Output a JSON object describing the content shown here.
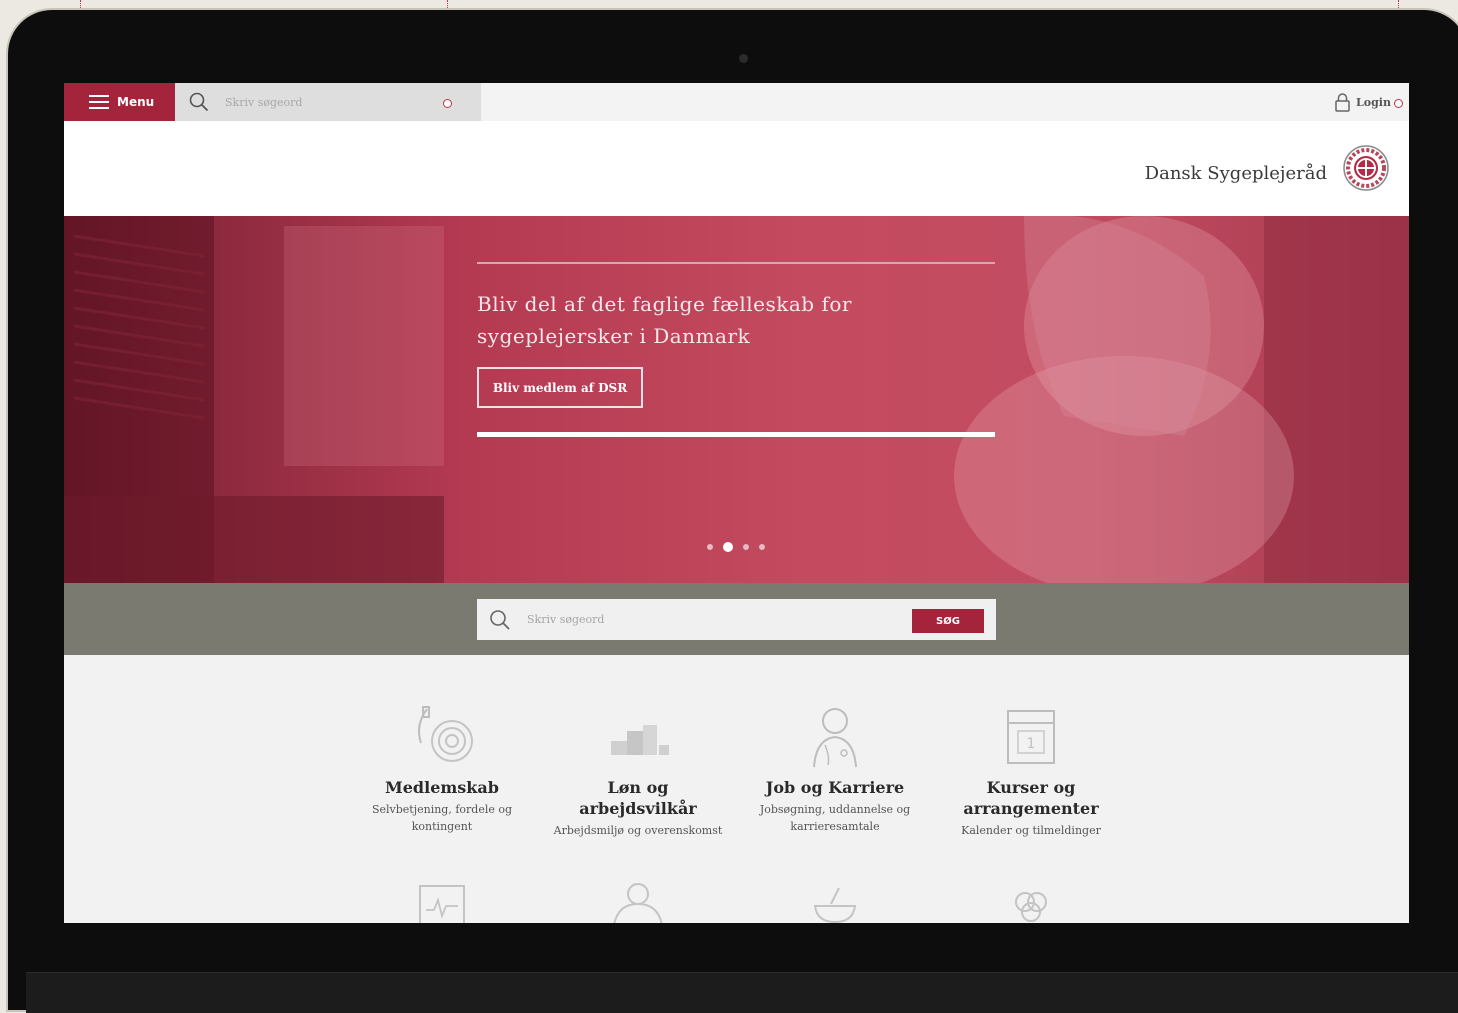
{
  "nav": {
    "menu_label": "Menu",
    "search_placeholder": "Skriv søgeord",
    "login_label": "Login"
  },
  "header": {
    "brand": "Dansk Sygeplejeråd"
  },
  "hero": {
    "headline_line1": "Bliv del af det faglige fælleskab for",
    "headline_line2": "sygeplejersker i Danmark",
    "cta_label": "Bliv medlem af DSR",
    "slide_count": 4,
    "active_slide": 2
  },
  "search": {
    "placeholder": "Skriv søgeord",
    "button_label": "SØG"
  },
  "tiles": [
    {
      "title": "Medlemskab",
      "subtitle": "Selvbetjening, fordele og kontingent",
      "icon": "membership-icon"
    },
    {
      "title": "Løn og arbejdsvilkår",
      "subtitle": "Arbejdsmiljø og overenskomst",
      "icon": "coins-icon"
    },
    {
      "title": "Job og Karriere",
      "subtitle": "Jobsøgning, uddannelse og karrieresamtale",
      "icon": "nurse-icon"
    },
    {
      "title": "Kurser og arrangementer",
      "subtitle": "Kalender og tilmeldinger",
      "icon": "calendar-icon"
    }
  ],
  "colors": {
    "brand_red": "#a4243c",
    "hero_tint": "#c44a5f",
    "search_band": "#7a7a70"
  }
}
